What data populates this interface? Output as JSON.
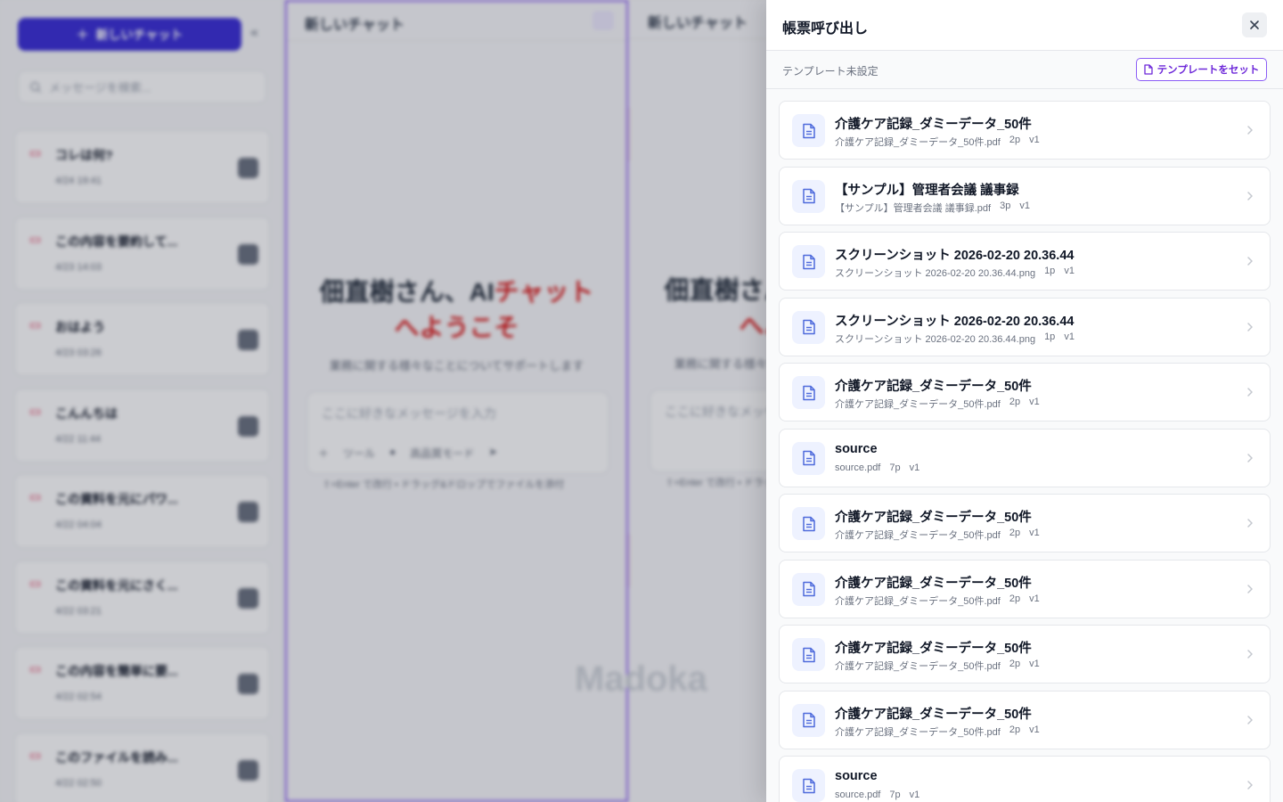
{
  "background": {
    "sidebar": {
      "new_chat_label": "新しいチャット",
      "search_placeholder": "メッセージを検索...",
      "chats": [
        {
          "title": "コレは何?",
          "time": "4/24 19:41"
        },
        {
          "title": "この内容を要約して...",
          "time": "4/23 14:03"
        },
        {
          "title": "おはよう",
          "time": "4/23 03:26"
        },
        {
          "title": "こんんちは",
          "time": "4/22 11:44"
        },
        {
          "title": "この資料を元にパワ...",
          "time": "4/22 04:04"
        },
        {
          "title": "この資料を元にさく...",
          "time": "4/22 03:21"
        },
        {
          "title": "この内容を簡単に要...",
          "time": "4/22 02:54"
        },
        {
          "title": "このファイルを読み...",
          "time": "4/22 02:50"
        }
      ]
    },
    "pane": {
      "title": "新しいチャット",
      "welcome_line1_a": "佃直樹さん、AI",
      "welcome_line1_b": "チャット",
      "welcome_line2": "へようこそ",
      "subtitle": "業務に関する様々なことについてサポートします",
      "input_placeholder": "ここに好きなメッセージを入力",
      "tool_label": "ツール",
      "mode_label": "高品質モード",
      "hint": "⇧+Enter で改行 • ドラッグ&ドロップでファイルを添付",
      "logo_text": "Madoka"
    }
  },
  "panel": {
    "title": "帳票呼び出し",
    "template_status": "テンプレート未設定",
    "set_template_label": "テンプレートをセット",
    "documents": [
      {
        "title": "介護ケア記録_ダミーデータ_50件",
        "file": "介護ケア記録_ダミーデータ_50件.pdf",
        "pages": "2p",
        "version": "v1"
      },
      {
        "title": "【サンプル】管理者会議 議事録",
        "file": "【サンプル】管理者会議 議事録.pdf",
        "pages": "3p",
        "version": "v1"
      },
      {
        "title": "スクリーンショット 2026-02-20 20.36.44",
        "file": "スクリーンショット 2026-02-20 20.36.44.png",
        "pages": "1p",
        "version": "v1"
      },
      {
        "title": "スクリーンショット 2026-02-20 20.36.44",
        "file": "スクリーンショット 2026-02-20 20.36.44.png",
        "pages": "1p",
        "version": "v1"
      },
      {
        "title": "介護ケア記録_ダミーデータ_50件",
        "file": "介護ケア記録_ダミーデータ_50件.pdf",
        "pages": "2p",
        "version": "v1"
      },
      {
        "title": "source",
        "file": "source.pdf",
        "pages": "7p",
        "version": "v1"
      },
      {
        "title": "介護ケア記録_ダミーデータ_50件",
        "file": "介護ケア記録_ダミーデータ_50件.pdf",
        "pages": "2p",
        "version": "v1"
      },
      {
        "title": "介護ケア記録_ダミーデータ_50件",
        "file": "介護ケア記録_ダミーデータ_50件.pdf",
        "pages": "2p",
        "version": "v1"
      },
      {
        "title": "介護ケア記録_ダミーデータ_50件",
        "file": "介護ケア記録_ダミーデータ_50件.pdf",
        "pages": "2p",
        "version": "v1"
      },
      {
        "title": "介護ケア記録_ダミーデータ_50件",
        "file": "介護ケア記録_ダミーデータ_50件.pdf",
        "pages": "2p",
        "version": "v1"
      },
      {
        "title": "source",
        "file": "source.pdf",
        "pages": "7p",
        "version": "v1"
      }
    ]
  }
}
